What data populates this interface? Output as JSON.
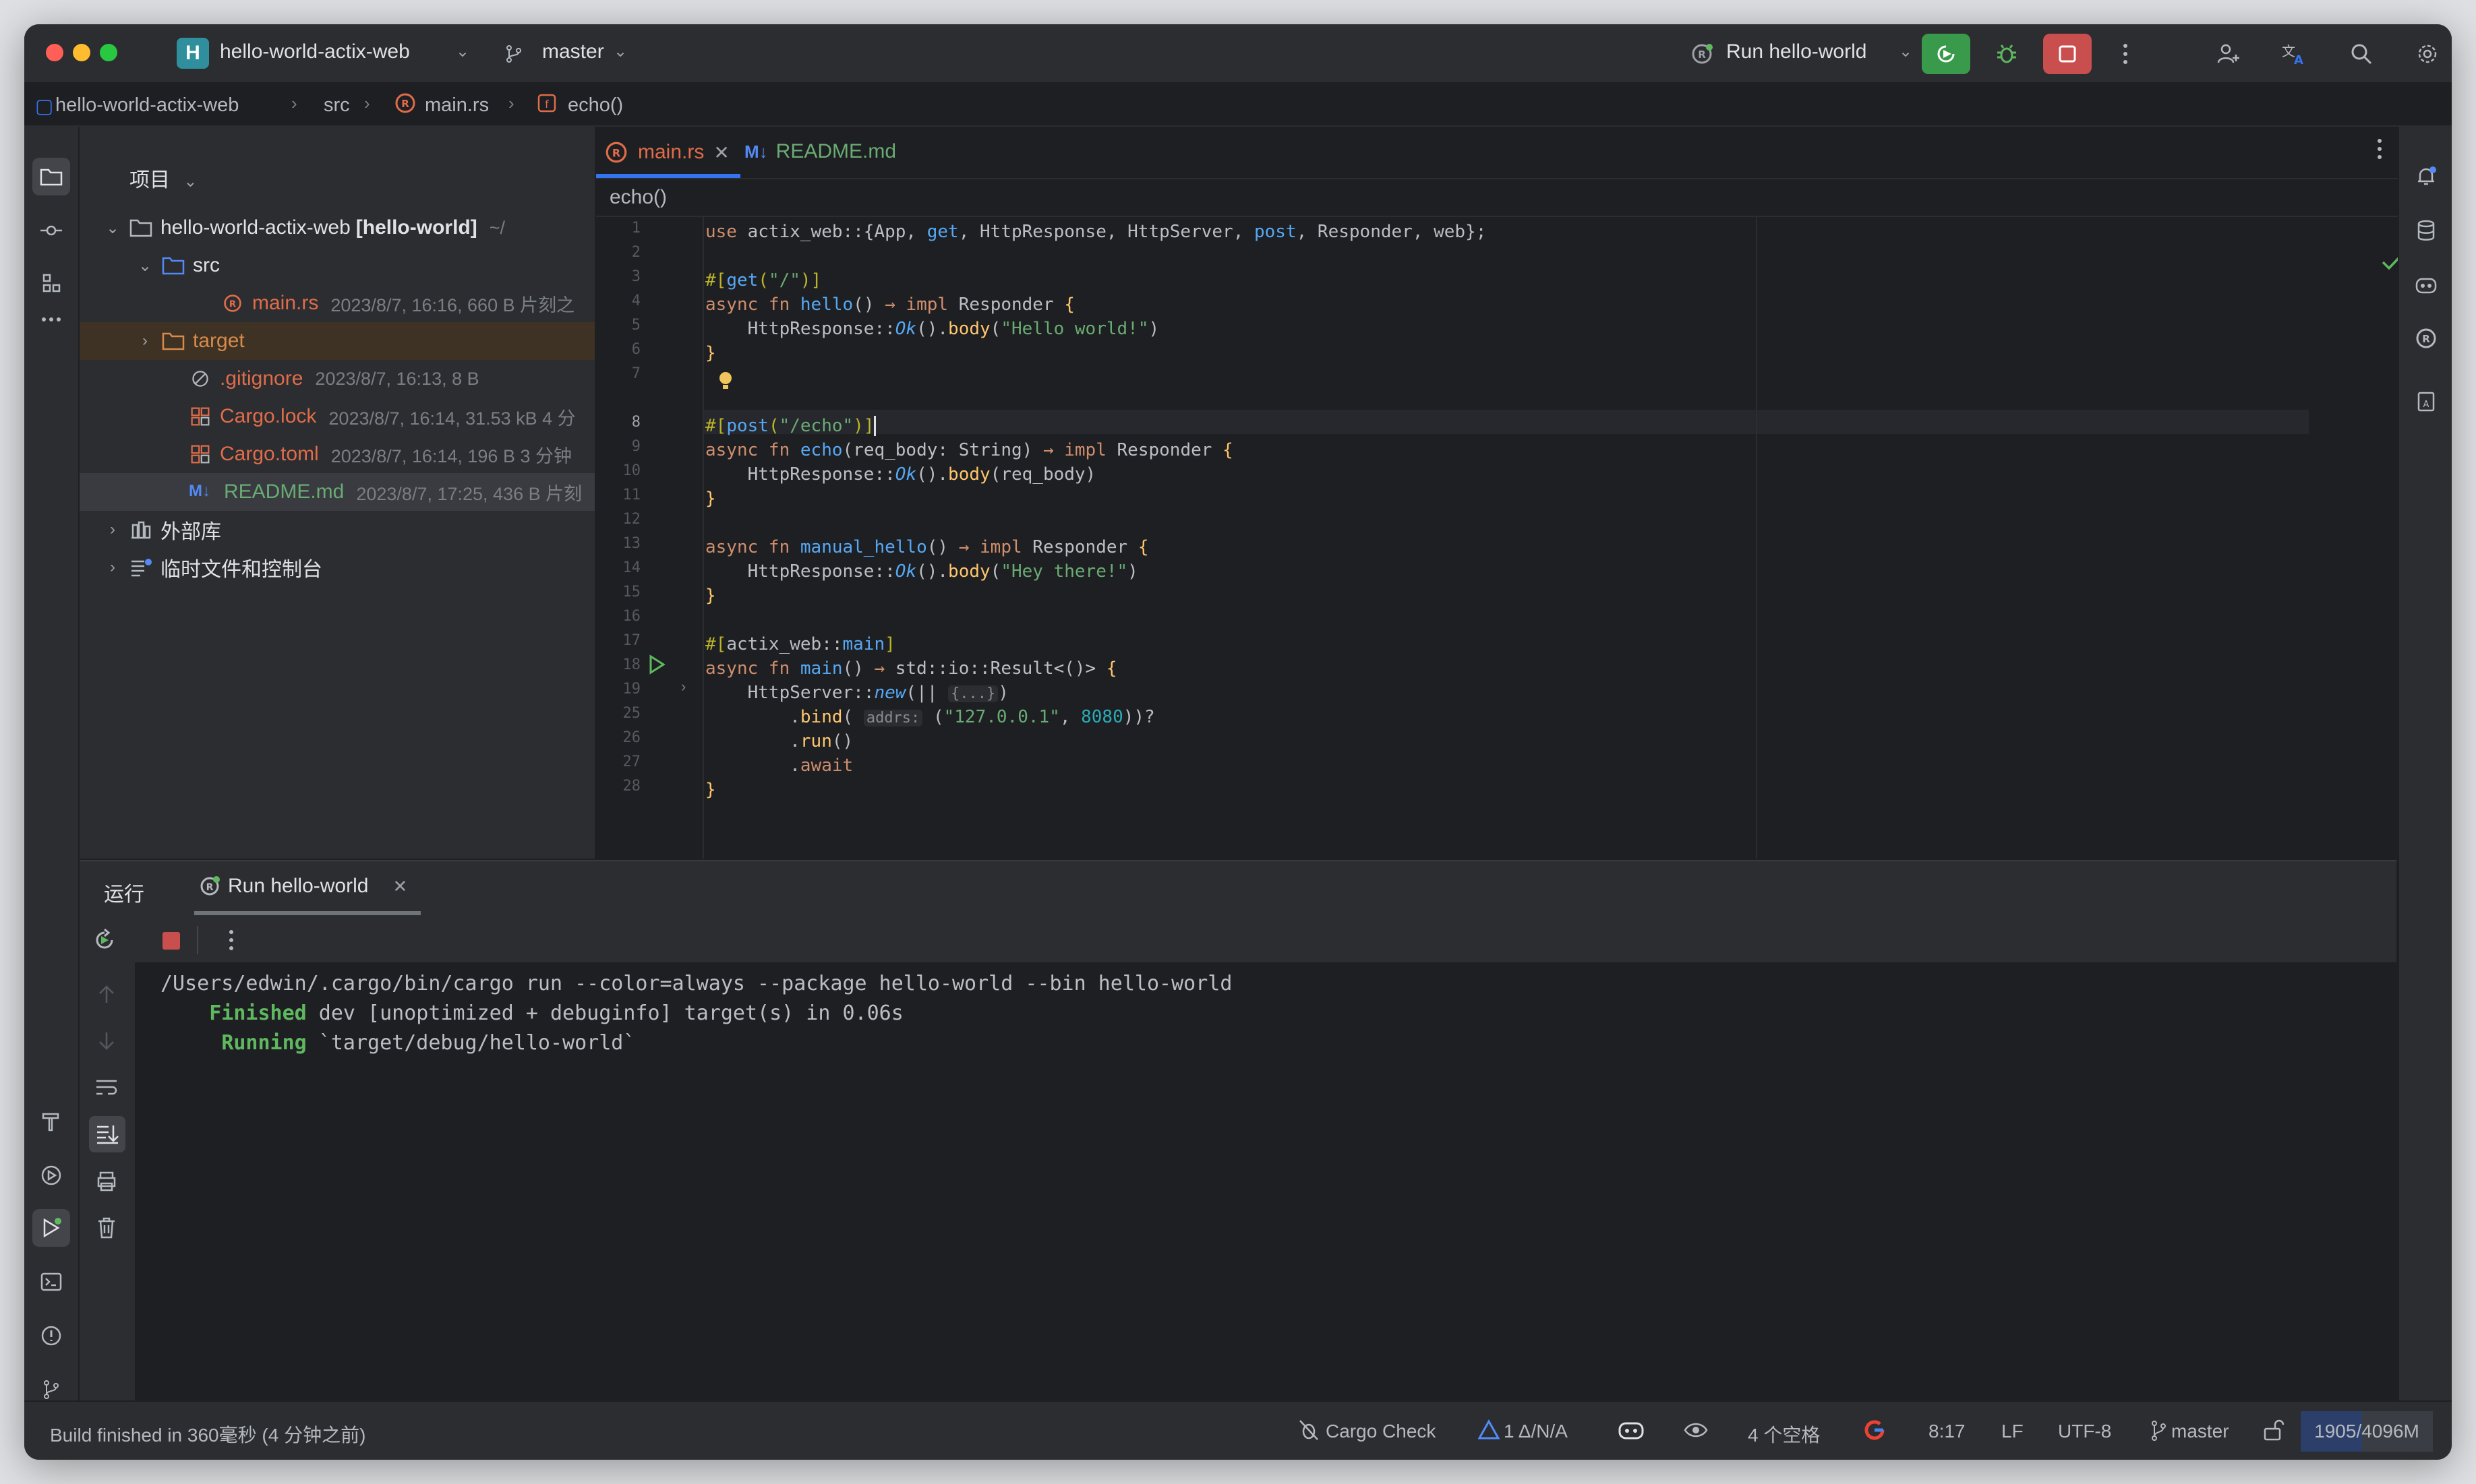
{
  "titlebar": {
    "project_badge": "H",
    "project_name": "hello-world-actix-web",
    "branch": "master",
    "run_config": "Run hello-world"
  },
  "breadcrumb": {
    "items": [
      "hello-world-actix-web",
      "src",
      "main.rs",
      "echo()"
    ]
  },
  "project_panel": {
    "title": "项目",
    "tree": [
      {
        "name": "hello-world-actix-web",
        "bold": "[hello-world]",
        "meta": "~/"
      },
      {
        "name": "src",
        "meta": ""
      },
      {
        "name": "main.rs",
        "meta": "2023/8/7, 16:16, 660 B 片刻之"
      },
      {
        "name": "target",
        "meta": ""
      },
      {
        "name": ".gitignore",
        "meta": "2023/8/7, 16:13, 8 B"
      },
      {
        "name": "Cargo.lock",
        "meta": "2023/8/7, 16:14, 31.53 kB 4 分"
      },
      {
        "name": "Cargo.toml",
        "meta": "2023/8/7, 16:14, 196 B 3 分钟"
      },
      {
        "name": "README.md",
        "meta": "2023/8/7, 17:25, 436 B 片刻"
      },
      {
        "name": "外部库",
        "meta": ""
      },
      {
        "name": "临时文件和控制台",
        "meta": ""
      }
    ]
  },
  "editor": {
    "tabs": [
      {
        "label": "main.rs",
        "active": true
      },
      {
        "label": "README.md",
        "active": false
      }
    ],
    "function_crumb": "echo()",
    "line_numbers": [
      "1",
      "2",
      "3",
      "4",
      "5",
      "6",
      "7",
      "8",
      "9",
      "10",
      "11",
      "12",
      "13",
      "14",
      "15",
      "16",
      "17",
      "18",
      "19",
      "25",
      "26",
      "27",
      "28"
    ],
    "cursor_line": "8"
  },
  "run_panel": {
    "title": "运行",
    "tab_label": "Run hello-world",
    "console": {
      "line1": "/Users/edwin/.cargo/bin/cargo run --color=always --package hello-world --bin hello-world",
      "line2_status": "Finished",
      "line2_rest": " dev [unoptimized + debuginfo] target(s) in 0.06s",
      "line3_status": "Running",
      "line3_rest": " `target/debug/hello-world`"
    }
  },
  "statusbar": {
    "message": "Build finished in 360毫秒 (4 分钟之前)",
    "cargo_check": "Cargo Check",
    "problems": "1 Δ/N/A",
    "indent": "4 个空格",
    "position": "8:17",
    "line_sep": "LF",
    "encoding": "UTF-8",
    "branch": "master",
    "memory": "1905/4096M",
    "memory_used_fraction": 0.465
  },
  "colors": {
    "accent": "#3574f0",
    "run_green": "#3a9a4c",
    "stop_red": "#c94f4f",
    "rust_orange": "#e06c4a"
  }
}
